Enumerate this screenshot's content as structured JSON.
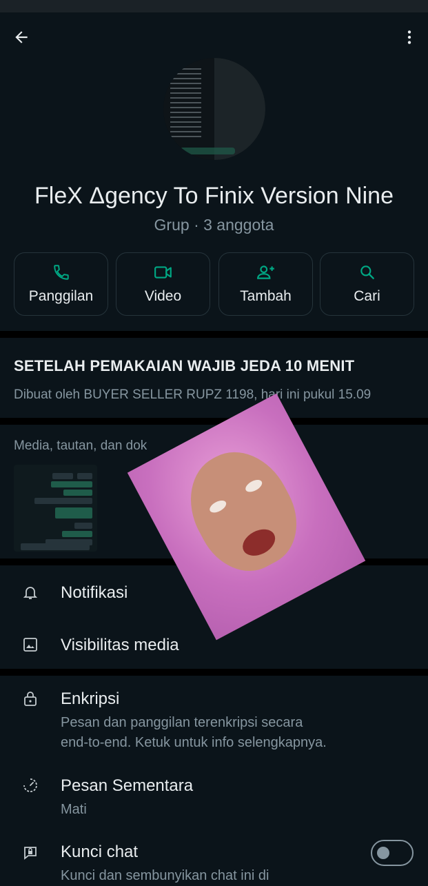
{
  "header": {
    "back_icon": "arrow-left-icon",
    "more_icon": "more-vertical-icon"
  },
  "group": {
    "name": "FleX Δgency To Finix Version Nine",
    "subtitle": "Grup · 3 anggota"
  },
  "actions": [
    {
      "label": "Panggilan",
      "icon": "phone-icon"
    },
    {
      "label": "Video",
      "icon": "video-icon"
    },
    {
      "label": "Tambah",
      "icon": "add-person-icon"
    },
    {
      "label": "Cari",
      "icon": "search-icon"
    }
  ],
  "announcement": {
    "title": "SETELAH PEMAKAIAN WAJIB JEDA 10 MENIT",
    "meta": "Dibuat oleh BUYER SELLER RUPZ 1198, hari ini pukul 15.09"
  },
  "media": {
    "label": "Media, tautan, dan dok"
  },
  "settings": {
    "notifikasi": {
      "title": "Notifikasi",
      "icon": "bell-icon"
    },
    "visibilitas": {
      "title": "Visibilitas media",
      "icon": "image-icon"
    },
    "enkripsi": {
      "title": "Enkripsi",
      "desc_line1": "Pesan dan panggilan terenkripsi secara",
      "desc_line2": "end-to-end. Ketuk untuk info selengkapnya.",
      "icon": "lock-icon"
    },
    "pesan_sementara": {
      "title": "Pesan Sementara",
      "desc": "Mati",
      "icon": "timer-icon"
    },
    "kunci_chat": {
      "title": "Kunci chat",
      "desc": "Kunci dan sembunyikan chat ini di",
      "icon": "chat-lock-icon",
      "toggle_on": false
    }
  },
  "colors": {
    "background": "#0b141a",
    "accent_green": "#00a884",
    "secondary_text": "#8696a0"
  }
}
